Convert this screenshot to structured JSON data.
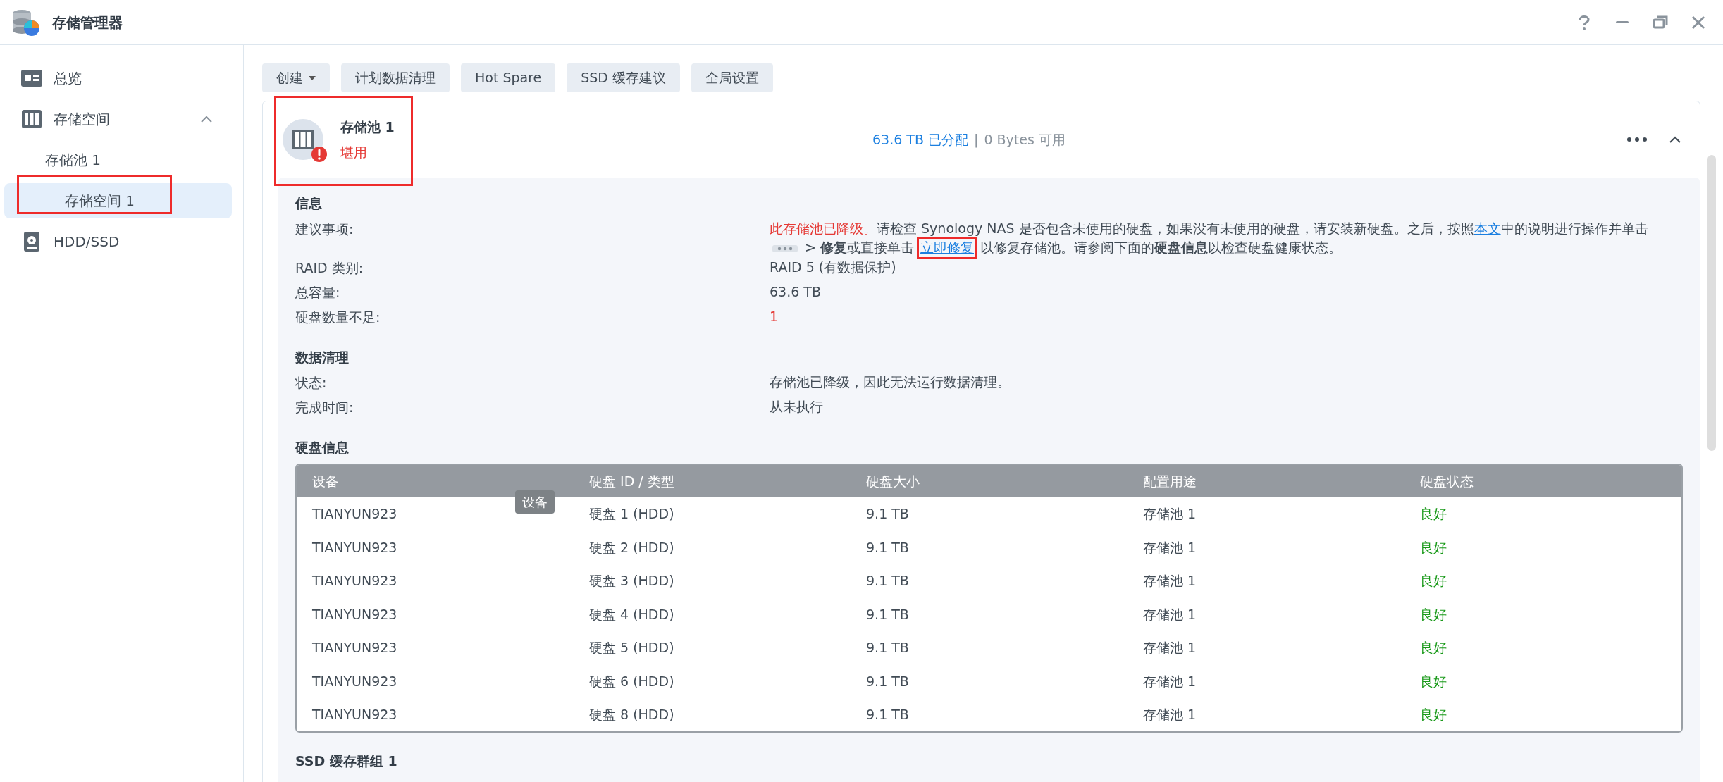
{
  "window": {
    "title": "存储管理器"
  },
  "sidebar": {
    "items": [
      {
        "label": "总览",
        "selected": false
      },
      {
        "label": "存储空间",
        "selected": false,
        "expanded": true,
        "children": [
          {
            "label": "存储池 1",
            "selected": false,
            "annotated": false
          },
          {
            "label": "存储空间 1",
            "selected": true,
            "annotated": true
          }
        ]
      },
      {
        "label": "HDD/SSD",
        "selected": false
      }
    ]
  },
  "toolbar": [
    {
      "label": "创建",
      "dropdown": true
    },
    {
      "label": "计划数据清理",
      "dropdown": false
    },
    {
      "label": "Hot Spare",
      "dropdown": false
    },
    {
      "label": "SSD 缓存建议",
      "dropdown": false
    },
    {
      "label": "全局设置",
      "dropdown": false
    }
  ],
  "pool": {
    "name": "存储池 1",
    "status": "堪用",
    "warning": true,
    "annotated": true,
    "allocated": "63.6 TB 已分配",
    "separator": "|",
    "available": "0 Bytes 可用",
    "expanded": true
  },
  "info": {
    "title": "信息",
    "advice_label": "建议事项:",
    "advice": [
      {
        "kind": "alert",
        "text": "此存储池已降级。"
      },
      {
        "kind": "text",
        "text": "请检查 Synology NAS 是否包含未使用的硬盘，如果没有未使用的硬盘，请安装新硬盘。之后，按照"
      },
      {
        "kind": "link",
        "text": "本文",
        "annotated": false
      },
      {
        "kind": "text",
        "text": "中的说明进行操作并单击"
      },
      {
        "kind": "more"
      },
      {
        "kind": "text",
        "text": " > **修复**或直接单击"
      },
      {
        "kind": "link",
        "text": "立即修复",
        "annotated": true
      },
      {
        "kind": "text",
        "text": "以修复存储池。请参阅下面的**硬盘信息**以检查硬盘健康状态。"
      }
    ],
    "rows": [
      {
        "label": "RAID 类别:",
        "value": "RAID 5 (有数据保护)",
        "alert": false
      },
      {
        "label": "总容量:",
        "value": "63.6 TB",
        "alert": false
      },
      {
        "label": "硬盘数量不足:",
        "value": "1",
        "alert": true
      }
    ]
  },
  "scrub": {
    "title": "数据清理",
    "rows": [
      {
        "label": "状态:",
        "value": "存储池已降级，因此无法运行数据清理。",
        "alert": false
      },
      {
        "label": "完成时间:",
        "value": "从未执行",
        "alert": false
      }
    ]
  },
  "disks": {
    "title": "硬盘信息",
    "columns": [
      "设备",
      "硬盘 ID / 类型",
      "硬盘大小",
      "配置用途",
      "硬盘状态"
    ],
    "tooltip": "设备",
    "rows": [
      {
        "device": "TIANYUN923",
        "id": "硬盘 1 (HDD)",
        "size": "9.1 TB",
        "usage": "存储池 1",
        "status": "良好",
        "ok": true
      },
      {
        "device": "TIANYUN923",
        "id": "硬盘 2 (HDD)",
        "size": "9.1 TB",
        "usage": "存储池 1",
        "status": "良好",
        "ok": true
      },
      {
        "device": "TIANYUN923",
        "id": "硬盘 3 (HDD)",
        "size": "9.1 TB",
        "usage": "存储池 1",
        "status": "良好",
        "ok": true
      },
      {
        "device": "TIANYUN923",
        "id": "硬盘 4 (HDD)",
        "size": "9.1 TB",
        "usage": "存储池 1",
        "status": "良好",
        "ok": true
      },
      {
        "device": "TIANYUN923",
        "id": "硬盘 5 (HDD)",
        "size": "9.1 TB",
        "usage": "存储池 1",
        "status": "良好",
        "ok": true
      },
      {
        "device": "TIANYUN923",
        "id": "硬盘 6 (HDD)",
        "size": "9.1 TB",
        "usage": "存储池 1",
        "status": "良好",
        "ok": true
      },
      {
        "device": "TIANYUN923",
        "id": "硬盘 8 (HDD)",
        "size": "9.1 TB",
        "usage": "存储池 1",
        "status": "良好",
        "ok": true
      }
    ]
  },
  "ssd_cache": {
    "title": "SSD 缓存群组 1"
  }
}
